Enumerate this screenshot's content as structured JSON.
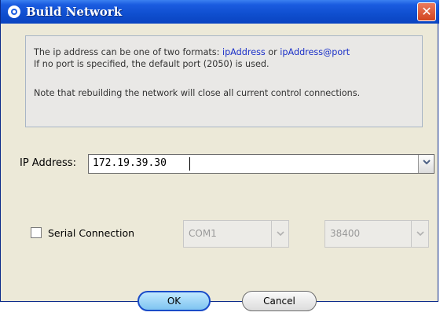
{
  "window": {
    "title": "Build Network",
    "close_label": "✕"
  },
  "info": {
    "line1_prefix": "The ip address can be one of two formats: ",
    "format1": "ipAddress",
    "line1_or": " or ",
    "format2": "ipAddress@port",
    "line2": "If no port is specified, the default port (2050) is used.",
    "line3": "Note that rebuilding the network will close all current control connections."
  },
  "ip": {
    "label": "IP Address:",
    "value": "172.19.39.30"
  },
  "serial": {
    "checked": false,
    "label": "Serial Connection",
    "port_value": "COM1",
    "baud_value": "38400"
  },
  "buttons": {
    "ok": "OK",
    "cancel": "Cancel"
  },
  "colors": {
    "titlebar": "#0f4ecf",
    "link": "#1b30c8",
    "dialog_bg": "#ece9d8"
  }
}
